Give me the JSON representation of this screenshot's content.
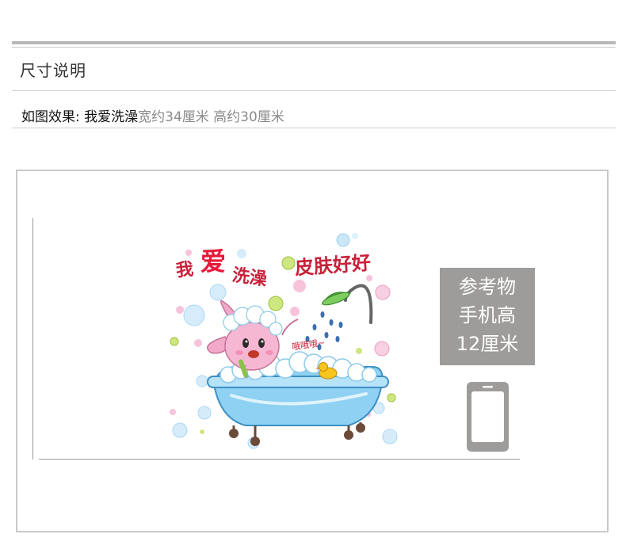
{
  "section": {
    "title": "尺寸说明"
  },
  "description": {
    "label": "如图效果: 我爱洗澡",
    "dimensions": "宽约34厘米 高约30厘米"
  },
  "artwork": {
    "title_chars": [
      "我",
      "爱",
      "洗澡",
      "皮肤好好"
    ],
    "sound_text": "哦哦哦~"
  },
  "reference": {
    "line1": "参考物",
    "line2": "手机高",
    "line3": "12厘米"
  },
  "colors": {
    "bar": "#b8b8b8",
    "reference_bg": "#9d9c9a",
    "tub": "#8fd1f2",
    "rabbit": "#f2a9c9",
    "title_red": "#c8213a"
  }
}
